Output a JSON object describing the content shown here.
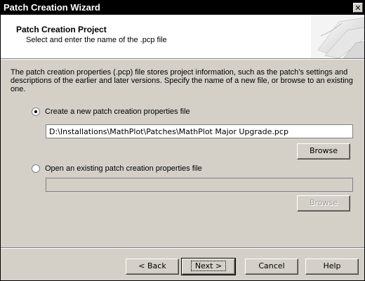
{
  "window": {
    "title": "Patch Creation Wizard",
    "close_glyph": "✕"
  },
  "header": {
    "title": "Patch Creation Project",
    "subtitle": "Select and enter the name of the .pcp file",
    "image_icon": "wizard-graphic-icon"
  },
  "description": "The patch creation properties (.pcp) file stores project information, such as the patch's settings and descriptions of the earlier and later versions. Specify the name of a new file, or browse to an existing one.",
  "option_new": {
    "label": "Create a new patch creation properties file",
    "selected": true,
    "path_value": "D:\\Installations\\MathPlot\\Patches\\MathPlot Major Upgrade.pcp",
    "browse_label": "Browse"
  },
  "option_existing": {
    "label": "Open an existing patch creation properties file",
    "selected": false,
    "path_value": "",
    "browse_label": "Browse"
  },
  "footer": {
    "back_label": "< Back",
    "next_label": "Next >",
    "cancel_label": "Cancel",
    "help_label": "Help"
  }
}
